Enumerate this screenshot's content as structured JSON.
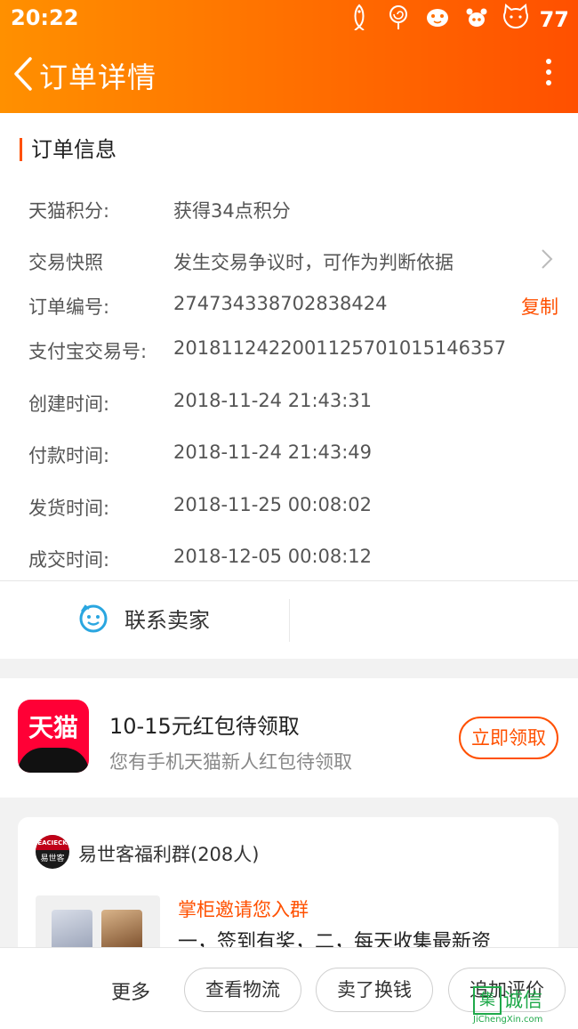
{
  "status_bar": {
    "time": "20:22",
    "battery": "77",
    "icons": [
      "fish-icon",
      "lollipop-icon",
      "pet-icon",
      "paw-icon",
      "cat-icon"
    ]
  },
  "header": {
    "title": "订单详情",
    "bg_colors": [
      "#ff9000",
      "#ff5000"
    ]
  },
  "order_info": {
    "section_title": "订单信息",
    "rows": [
      {
        "label": "天猫积分:",
        "value": "获得34点积分"
      },
      {
        "label": "交易快照",
        "value": "发生交易争议时，可作为判断依据"
      },
      {
        "label": "订单编号:",
        "value": "274734338702838424",
        "action": "复制"
      },
      {
        "label": "支付宝交易号:",
        "value": "2018112422001125701015146357"
      },
      {
        "label": "创建时间:",
        "value": "2018-11-24 21:43:31"
      },
      {
        "label": "付款时间:",
        "value": "2018-11-24 21:43:49"
      },
      {
        "label": "发货时间:",
        "value": "2018-11-25 00:08:02"
      },
      {
        "label": "成交时间:",
        "value": "2018-12-05 00:08:12"
      }
    ],
    "contact_seller": "联系卖家"
  },
  "promo": {
    "logo_text": "天猫",
    "title": "10-15元红包待领取",
    "subtitle": "您有手机天猫新人红包待领取",
    "button": "立即领取"
  },
  "group": {
    "avatar_top": "EACIECK",
    "avatar_bottom": "易世客",
    "name": "易世客福利群(208人)",
    "invite": "掌柜邀请您入群",
    "message": "一，签到有奖，二，每天收集最新资"
  },
  "bottom_bar": {
    "more": "更多",
    "buttons": [
      "查看物流",
      "卖了换钱",
      "追加评价"
    ]
  },
  "watermark": {
    "glyph": "集",
    "text": "诚信",
    "url": "JiChengXin.com"
  },
  "colors": {
    "accent": "#ff5000",
    "tmall_red": "#ff0036"
  }
}
